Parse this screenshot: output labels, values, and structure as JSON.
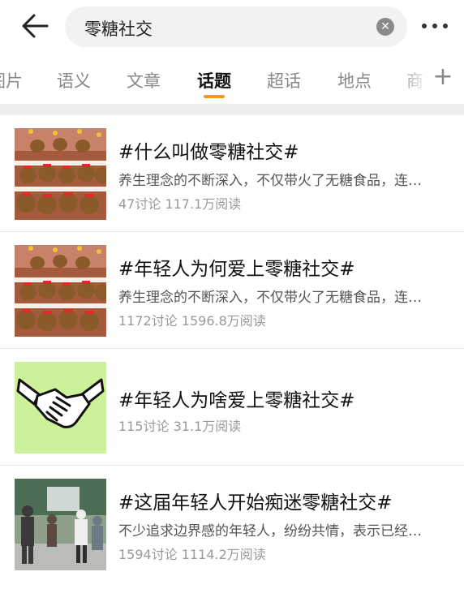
{
  "search": {
    "query": "零糖社交",
    "clear_icon": "close-circle-icon"
  },
  "nav": {
    "back_icon": "arrow-left-icon",
    "more_icon": "more-dots-icon"
  },
  "tabs": [
    {
      "label": "图片"
    },
    {
      "label": "语义"
    },
    {
      "label": "文章"
    },
    {
      "label": "话题",
      "active": true
    },
    {
      "label": "超话"
    },
    {
      "label": "地点"
    },
    {
      "label": "商"
    }
  ],
  "accent_color": "#f29a1a",
  "topics": [
    {
      "title": "#什么叫做零糖社交#",
      "desc": "养生理念的不断深入，不仅带火了无糖食品，连…",
      "stats": "47讨论 117.1万阅读",
      "thumb": "capybara-plush-display"
    },
    {
      "title": "#年轻人为何爱上零糖社交#",
      "desc": "养生理念的不断深入，不仅带火了无糖食品，连…",
      "stats": "1172讨论 1596.8万阅读",
      "thumb": "capybara-plush-display"
    },
    {
      "title": "#年轻人为啥爱上零糖社交#",
      "desc": "",
      "stats": "115讨论 31.1万阅读",
      "thumb": "handshake-illustration"
    },
    {
      "title": "#这届年轻人开始痴迷零糖社交#",
      "desc": "不少追求边界感的年轻人，纷纷共情，表示已经…",
      "stats": "1594讨论 1114.2万阅读",
      "thumb": "people-outdoor-photo"
    }
  ]
}
